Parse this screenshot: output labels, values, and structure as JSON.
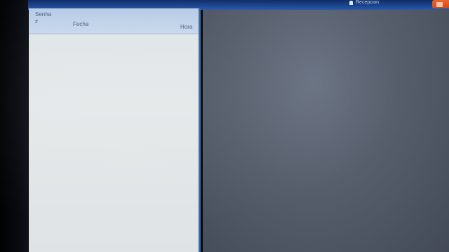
{
  "topbar": {
    "user_name": "Recepcion",
    "action_label": ""
  },
  "turns_panel": {
    "title": "Senha",
    "col_number": "#",
    "col_date": "Fecha",
    "col_time": "Hora",
    "rows": []
  },
  "colors": {
    "topbar": "#1f4a97",
    "panel_bg": "#e2e6e8",
    "panel_header": "#c2d3ea",
    "main_bg": "#5a6270",
    "action_button": "#d9521f"
  }
}
